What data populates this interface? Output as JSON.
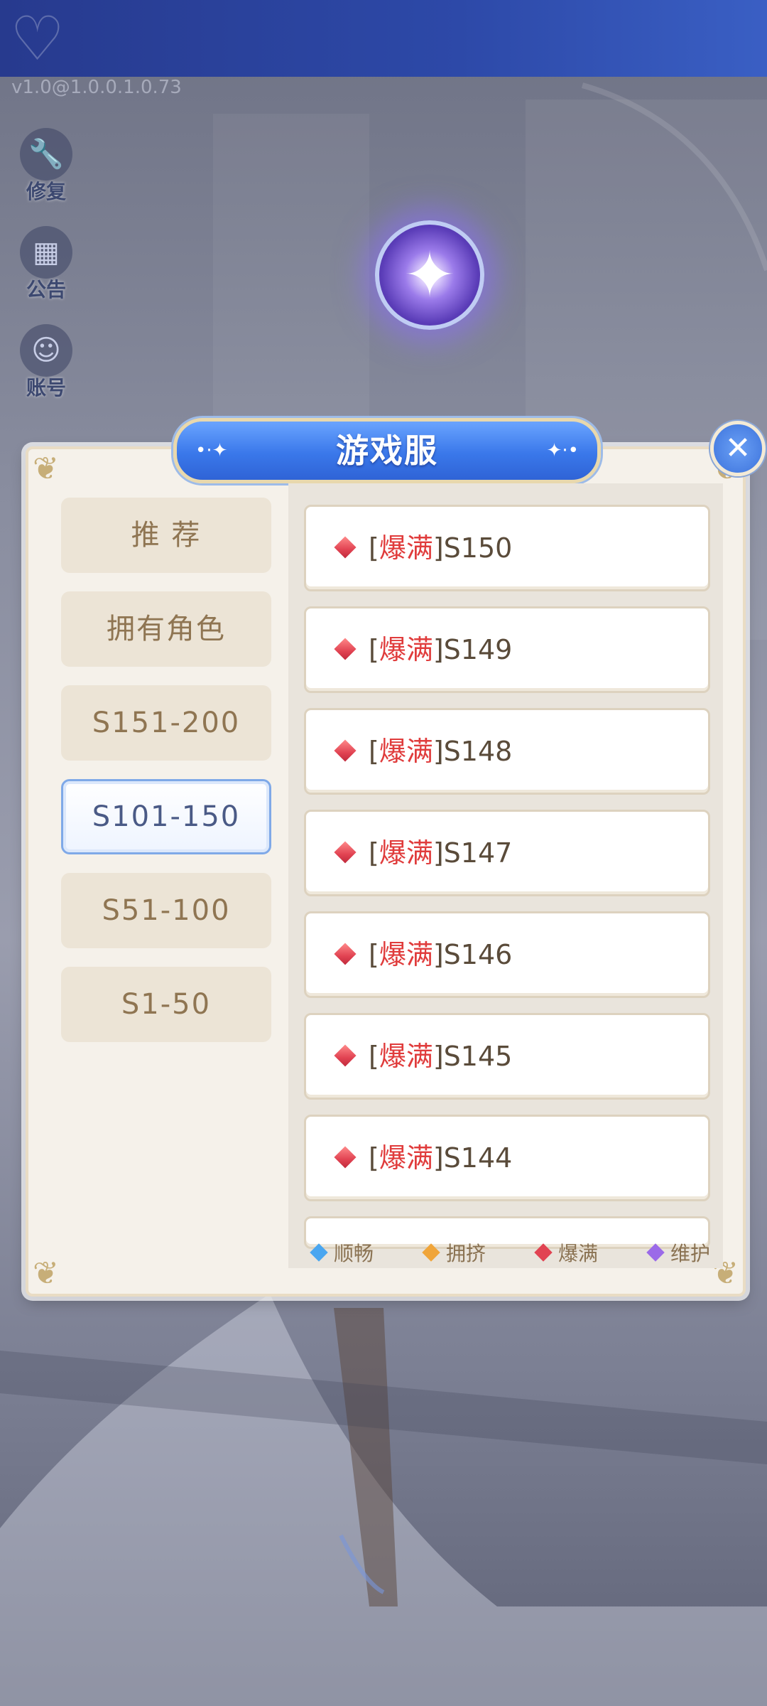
{
  "header": {
    "version": "v1.0@1.0.0.1.0.73"
  },
  "side_buttons": [
    {
      "label": "修复",
      "icon": "wrench-icon"
    },
    {
      "label": "公告",
      "icon": "notice-icon"
    },
    {
      "label": "账号",
      "icon": "account-icon"
    }
  ],
  "dialog": {
    "title": "游戏服",
    "close_icon": "close-icon",
    "categories": [
      {
        "label": "推 荐",
        "active": false
      },
      {
        "label": "拥有角色",
        "active": false
      },
      {
        "label": "S151-200",
        "active": false
      },
      {
        "label": "S101-150",
        "active": true
      },
      {
        "label": "S51-100",
        "active": false
      },
      {
        "label": "S1-50",
        "active": false
      }
    ],
    "servers": [
      {
        "bracket_open": "[",
        "status": "爆满",
        "bracket_close": "]",
        "name": "S150"
      },
      {
        "bracket_open": "[",
        "status": "爆满",
        "bracket_close": "]",
        "name": "S149"
      },
      {
        "bracket_open": "[",
        "status": "爆满",
        "bracket_close": "]",
        "name": "S148"
      },
      {
        "bracket_open": "[",
        "status": "爆满",
        "bracket_close": "]",
        "name": "S147"
      },
      {
        "bracket_open": "[",
        "status": "爆满",
        "bracket_close": "]",
        "name": "S146"
      },
      {
        "bracket_open": "[",
        "status": "爆满",
        "bracket_close": "]",
        "name": "S145"
      },
      {
        "bracket_open": "[",
        "status": "爆满",
        "bracket_close": "]",
        "name": "S144"
      }
    ],
    "legend": [
      {
        "label": "顺畅",
        "color": "#4aa6f0"
      },
      {
        "label": "拥挤",
        "color": "#f0a53a"
      },
      {
        "label": "爆满",
        "color": "#e14352"
      },
      {
        "label": "维护",
        "color": "#9b6ae8"
      }
    ]
  }
}
